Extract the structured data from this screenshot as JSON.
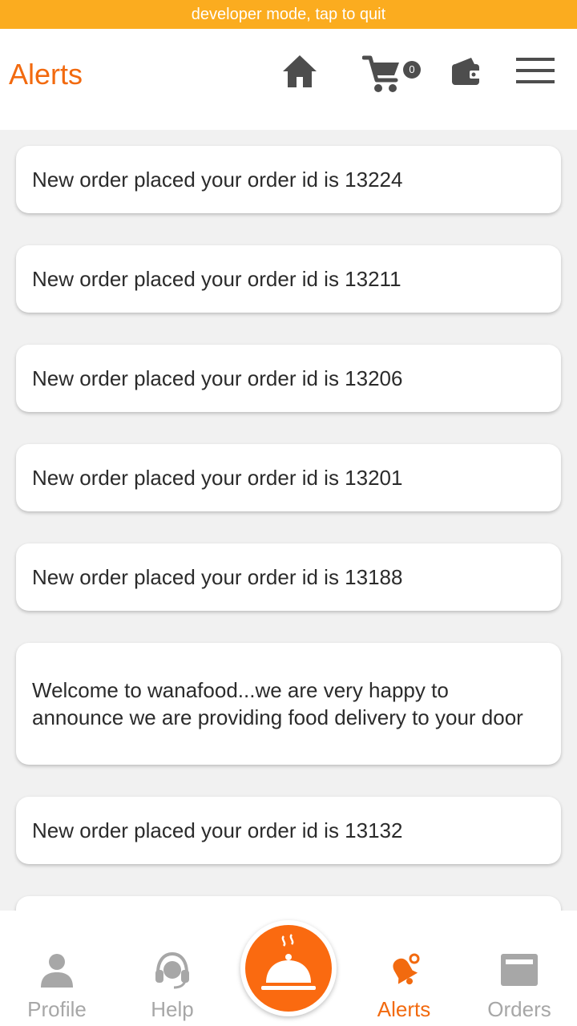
{
  "dev_banner": "developer mode, tap to quit",
  "header": {
    "title": "Alerts",
    "cart_count": "0",
    "icons": [
      "home-icon",
      "cart-icon",
      "wallet-icon",
      "menu-icon"
    ]
  },
  "alerts": [
    "New order placed your order id is 13224",
    "New order placed your order id is 13211",
    "New order placed your order id is 13206",
    "New order placed your order id is 13201",
    "New order placed your order id is 13188",
    "Welcome to wanafood...we are very happy to announce we are  providing food delivery to your door",
    "New order placed your order id is 13132"
  ],
  "tabs": [
    {
      "label": "Profile",
      "icon": "profile-icon"
    },
    {
      "label": "Help",
      "icon": "headset-icon"
    },
    {
      "label": "Alerts",
      "icon": "bell-icon",
      "active": true
    },
    {
      "label": "Orders",
      "icon": "orders-icon"
    }
  ],
  "center_button_icon": "food-cloche-icon",
  "colors": {
    "accent": "#f26a0f",
    "banner": "#fbac1f",
    "icon_dark": "#4d4d4d",
    "inactive": "#a7a7a7",
    "background": "#f1f1f1"
  }
}
